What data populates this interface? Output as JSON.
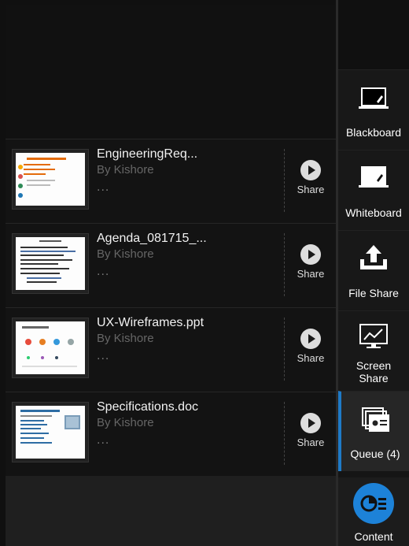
{
  "queue": {
    "items": [
      {
        "name": "EngineeringReq...",
        "owner": "By Kishore",
        "more": "...",
        "share_label": "Share",
        "thumb": "engineering"
      },
      {
        "name": "Agenda_081715_...",
        "owner": "By Kishore",
        "more": "...",
        "share_label": "Share",
        "thumb": "agenda"
      },
      {
        "name": "UX-Wireframes.ppt",
        "owner": "By Kishore",
        "more": "...",
        "share_label": "Share",
        "thumb": "wireframes"
      },
      {
        "name": "Specifications.doc",
        "owner": "By Kishore",
        "more": "...",
        "share_label": "Share",
        "thumb": "specs"
      }
    ]
  },
  "sidebar": {
    "blackboard": "Blackboard",
    "whiteboard": "Whiteboard",
    "file_share": "File Share",
    "screen_share_line1": "Screen",
    "screen_share_line2": "Share",
    "queue": "Queue (4)",
    "content": "Content"
  },
  "colors": {
    "accent": "#1e7ac7",
    "content_circle": "#1d82d8"
  }
}
